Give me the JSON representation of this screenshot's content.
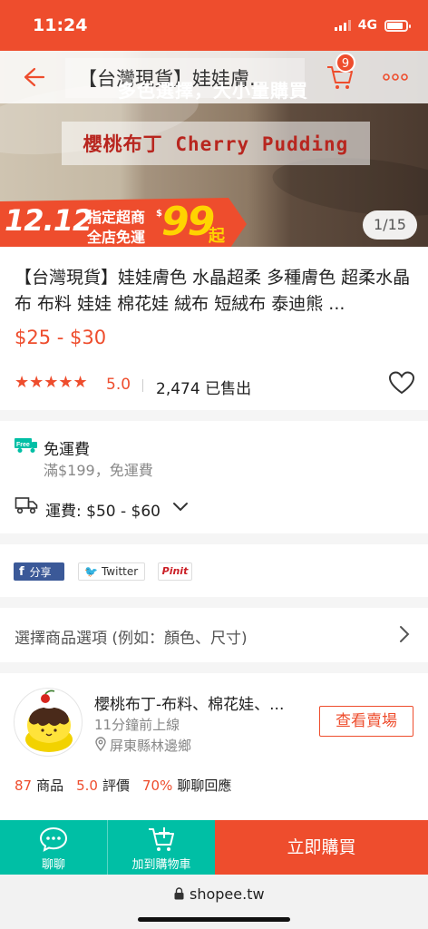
{
  "status_bar": {
    "time": "11:24",
    "network": "4G"
  },
  "header": {
    "title": "【台灣現貨】娃娃膚...",
    "overlay_text": "多色選擇，大小量購買",
    "cart_count": "9"
  },
  "hero": {
    "brand_text": "櫻桃布丁 Cherry Pudding",
    "promo": {
      "date": "12.12",
      "line1": "指定超商",
      "line2": "全店免運",
      "currency": "$",
      "amount": "99",
      "unit": "起"
    },
    "image_counter": "1/15"
  },
  "product": {
    "title": "【台灣現貨】娃娃膚色 水晶超柔 多種膚色 超柔水晶布 布料 娃娃 棉花娃 絨布 短絨布 泰迪熊 ...",
    "price": "$25 - $30",
    "stars": "★★★★★",
    "rating": "5.0",
    "sold": "2,474 已售出"
  },
  "shipping": {
    "free_badge": "Free",
    "free_title": "免運費",
    "free_subtitle": "滿$199，免運費",
    "fee": "運費: $50 - $60"
  },
  "share": {
    "facebook": "分享",
    "facebook_icon": "f",
    "twitter": "Twitter",
    "pinterest": "Pinit"
  },
  "options": {
    "label": "選擇商品選項 (例如：顏色、尺寸)"
  },
  "shop": {
    "name": "櫻桃布丁-布料、棉花娃、...",
    "last_online": "11分鐘前上線",
    "location": "屏東縣林邊鄉",
    "view_button": "查看賣場",
    "stats": [
      {
        "value": "87",
        "label": "商品"
      },
      {
        "value": "5.0",
        "label": "評價"
      },
      {
        "value": "70%",
        "label": "聊聊回應"
      }
    ]
  },
  "actions": {
    "chat": "聊聊",
    "add_to_cart": "加到購物車",
    "buy_now": "立即購買"
  },
  "browser": {
    "url": "shopee.tw"
  },
  "colors": {
    "brand": "#ee4d2d",
    "teal": "#00bfa5",
    "star": "#ee4d2d"
  }
}
